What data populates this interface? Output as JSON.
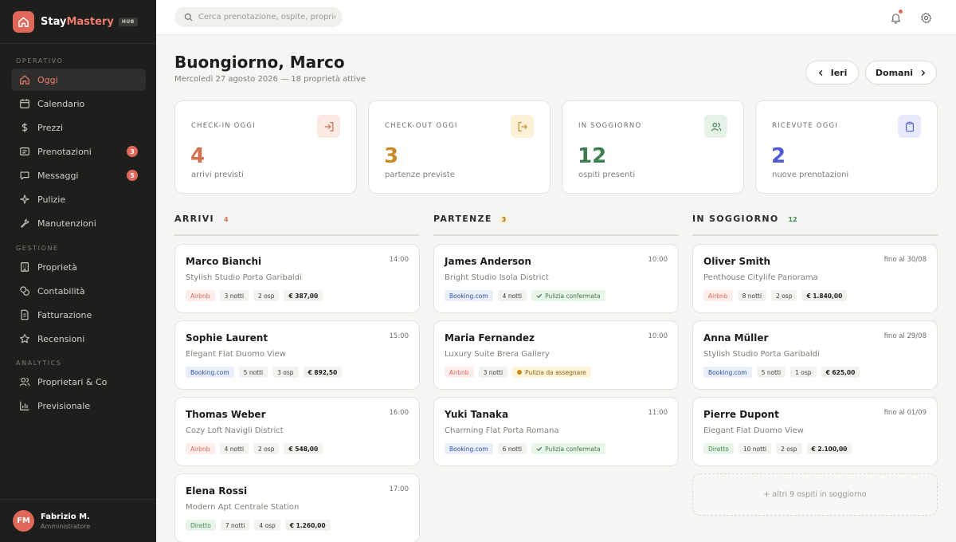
{
  "brand": {
    "name_main": "Stay",
    "name_accent": "Mastery",
    "tag": "HUB"
  },
  "sidebar": {
    "sections": [
      "OPERATIVO",
      "GESTIONE",
      "ANALYTICS"
    ],
    "items": [
      {
        "label": "Oggi",
        "icon": "home-icon",
        "active": true
      },
      {
        "label": "Calendario",
        "icon": "calendar-icon"
      },
      {
        "label": "Prezzi",
        "icon": "dollar-icon"
      },
      {
        "label": "Prenotazioni",
        "icon": "bookings-icon",
        "badge": "3"
      },
      {
        "label": "Messaggi",
        "icon": "message-icon",
        "badge": "5"
      },
      {
        "label": "Pulizie",
        "icon": "sparkle-icon"
      },
      {
        "label": "Manutenzioni",
        "icon": "wrench-icon"
      },
      {
        "label": "Proprietà",
        "icon": "building-icon"
      },
      {
        "label": "Contabilità",
        "icon": "coins-icon"
      },
      {
        "label": "Fatturazione",
        "icon": "invoice-icon"
      },
      {
        "label": "Recensioni",
        "icon": "star-icon"
      },
      {
        "label": "Proprietari & Co",
        "icon": "users-icon"
      },
      {
        "label": "Previsionale",
        "icon": "bar-chart-icon"
      }
    ],
    "user": {
      "initials": "FM",
      "name": "Fabrizio M.",
      "role": "Amministratore"
    }
  },
  "topbar": {
    "search_placeholder": "Cerca prenotazione, ospite, proprietà..."
  },
  "header": {
    "greeting": "Buongiorno, Marco",
    "date_line": "Mercoledì 27 agosto 2026 — 18 proprietà attive",
    "prev_label": "Ieri",
    "next_label": "Domani"
  },
  "kpis": [
    {
      "label": "CHECK-IN OGGI",
      "value": "4",
      "sub": "arrivi previsti",
      "color": "#d0704f",
      "icon": "login-icon"
    },
    {
      "label": "CHECK-OUT OGGI",
      "value": "3",
      "sub": "partenze previste",
      "color": "#c98a2a",
      "icon": "logout-icon"
    },
    {
      "label": "IN SOGGIORNO",
      "value": "12",
      "sub": "ospiti presenti",
      "color": "#3e7d4f",
      "icon": "guests-icon"
    },
    {
      "label": "RICEVUTE OGGI",
      "value": "2",
      "sub": "nuove prenotazioni",
      "color": "#4f5bd0",
      "icon": "clipboard-icon"
    }
  ],
  "columns": {
    "arrivi": {
      "title": "ARRIVI",
      "count": "4",
      "items": [
        {
          "name": "Marco Bianchi",
          "time": "14:00",
          "property": "Stylish Studio Porta Garibaldi",
          "channel": "Airbnb",
          "nights": "3 notti",
          "guests": "2 osp",
          "amount": "€ 387,00"
        },
        {
          "name": "Sophie Laurent",
          "time": "15:00",
          "property": "Elegant Flat Duomo View",
          "channel": "Booking.com",
          "nights": "5 notti",
          "guests": "3 osp",
          "amount": "€ 892,50"
        },
        {
          "name": "Thomas Weber",
          "time": "16:00",
          "property": "Cozy Loft Navigli District",
          "channel": "Airbnb",
          "nights": "4 notti",
          "guests": "2 osp",
          "amount": "€ 548,00"
        },
        {
          "name": "Elena Rossi",
          "time": "17:00",
          "property": "Modern Apt Centrale Station",
          "channel": "Diretto",
          "nights": "7 notti",
          "guests": "4 osp",
          "amount": "€ 1.260,00"
        }
      ]
    },
    "partenze": {
      "title": "PARTENZE",
      "count": "3",
      "items": [
        {
          "name": "James Anderson",
          "time": "10:00",
          "property": "Bright Studio Isola District",
          "channel": "Booking.com",
          "nights": "4 notti",
          "cleaning": "Pulizia confermata",
          "cleaning_state": "ok"
        },
        {
          "name": "Maria Fernandez",
          "time": "10:00",
          "property": "Luxury Suite Brera Gallery",
          "channel": "Airbnb",
          "nights": "3 notti",
          "cleaning": "Pulizia da assegnare",
          "cleaning_state": "todo"
        },
        {
          "name": "Yuki Tanaka",
          "time": "11:00",
          "property": "Charming Flat Porta Romana",
          "channel": "Booking.com",
          "nights": "6 notti",
          "cleaning": "Pulizia confermata",
          "cleaning_state": "ok"
        }
      ]
    },
    "soggiorno": {
      "title": "IN SOGGIORNO",
      "count": "12",
      "items": [
        {
          "name": "Oliver Smith",
          "time": "fino al 30/08",
          "property": "Penthouse Citylife Panorama",
          "channel": "Airbnb",
          "nights": "8 notti",
          "guests": "2 osp",
          "amount": "€ 1.840,00"
        },
        {
          "name": "Anna Müller",
          "time": "fino al 29/08",
          "property": "Stylish Studio Porta Garibaldi",
          "channel": "Booking.com",
          "nights": "5 notti",
          "guests": "1 osp",
          "amount": "€ 625,00"
        },
        {
          "name": "Pierre Dupont",
          "time": "fino al 01/09",
          "property": "Elegant Flat Duomo View",
          "channel": "Diretto",
          "nights": "10 notti",
          "guests": "2 osp",
          "amount": "€ 2.100,00"
        }
      ],
      "more": "+ altri 9 ospiti in soggiorno"
    }
  }
}
